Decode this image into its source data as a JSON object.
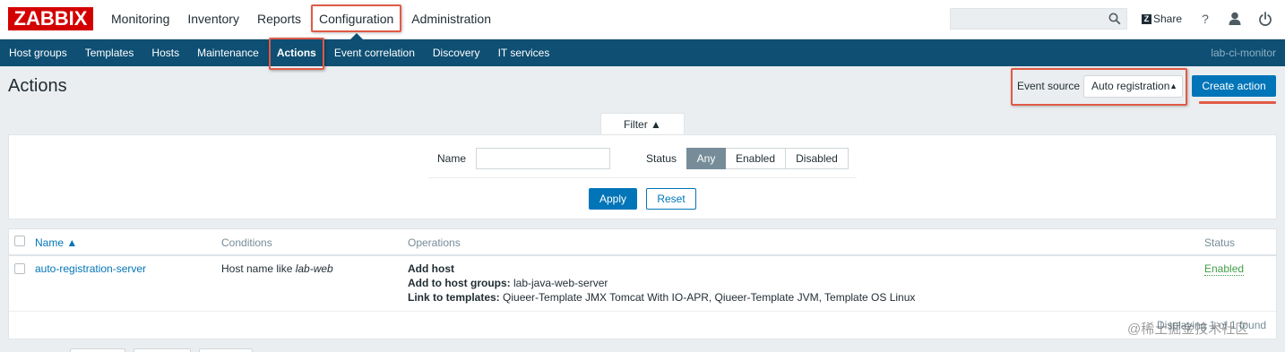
{
  "logo": "ZABBIX",
  "main_menu": [
    {
      "label": "Monitoring"
    },
    {
      "label": "Inventory"
    },
    {
      "label": "Reports"
    },
    {
      "label": "Configuration",
      "selected": true
    },
    {
      "label": "Administration"
    }
  ],
  "header_tools": {
    "share_label": "Share",
    "share_badge": "Z",
    "help_glyph": "?",
    "search_icon": "search-icon",
    "user_icon": "user-icon",
    "logout_icon": "power-icon"
  },
  "sub_menu": [
    {
      "label": "Host groups"
    },
    {
      "label": "Templates"
    },
    {
      "label": "Hosts"
    },
    {
      "label": "Maintenance"
    },
    {
      "label": "Actions",
      "selected": true
    },
    {
      "label": "Event correlation"
    },
    {
      "label": "Discovery"
    },
    {
      "label": "IT services"
    }
  ],
  "server_name": "lab-ci-monitor",
  "page_title": "Actions",
  "event_source": {
    "label": "Event source",
    "selected": "Auto registration"
  },
  "create_button": "Create action",
  "filter": {
    "tab_label": "Filter ▲",
    "name_label": "Name",
    "name_value": "",
    "status_label": "Status",
    "status_options": [
      "Any",
      "Enabled",
      "Disabled"
    ],
    "status_selected": "Any",
    "apply_label": "Apply",
    "reset_label": "Reset"
  },
  "table": {
    "headers": {
      "name": "Name ▲",
      "conditions": "Conditions",
      "operations": "Operations",
      "status": "Status"
    },
    "rows": [
      {
        "name": "auto-registration-server",
        "condition_prefix": "Host name like ",
        "condition_value": "lab-web",
        "op_title": "Add host",
        "op_groups_label": "Add to host groups:",
        "op_groups_value": " lab-java-web-server",
        "op_templates_label": "Link to templates:",
        "op_templates_value": " Qiueer-Template JMX Tomcat With IO-APR, Qiueer-Template JVM, Template OS Linux",
        "status": "Enabled"
      }
    ],
    "footer": "Displaying 1 of 1 found"
  },
  "watermark": "@稀土掘金技术社区",
  "colors": {
    "brand_red": "#d40000",
    "nav_blue": "#0e4f73",
    "primary_button": "#0275b8",
    "enabled_green": "#429e47",
    "annotation_red": "#e05a47"
  }
}
